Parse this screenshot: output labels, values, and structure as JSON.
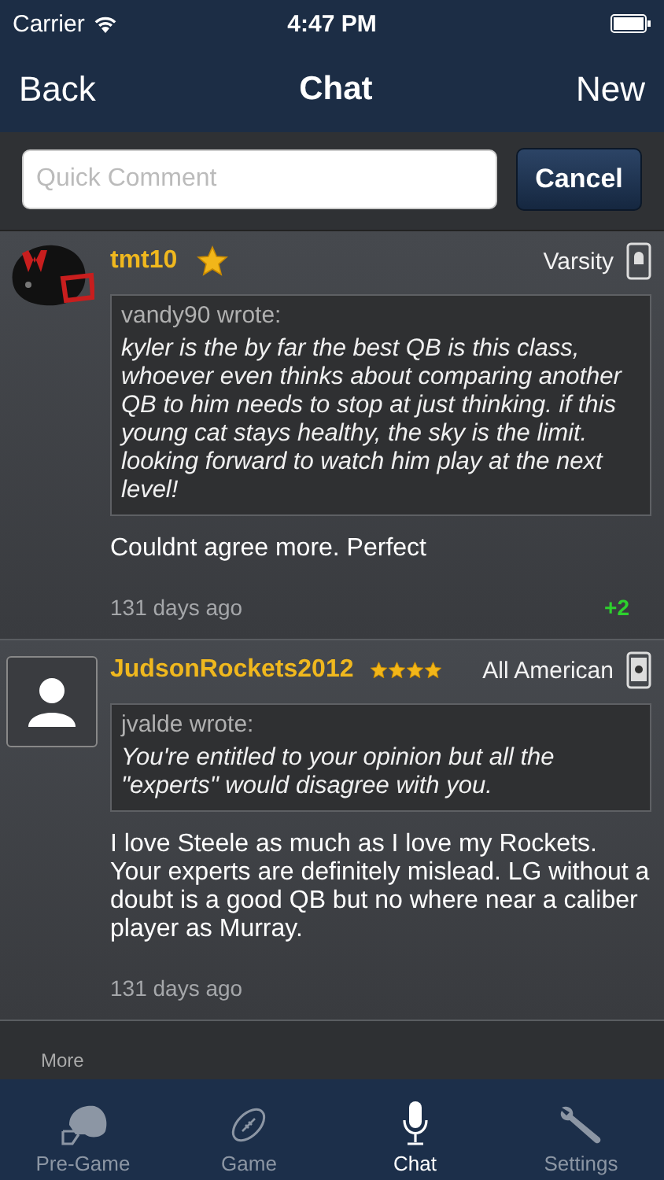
{
  "status_bar": {
    "carrier": "Carrier",
    "time": "4:47 PM"
  },
  "nav": {
    "back": "Back",
    "title": "Chat",
    "action": "New"
  },
  "comment": {
    "placeholder": "Quick Comment",
    "cancel": "Cancel"
  },
  "posts": [
    {
      "user": "tmt10",
      "rank": "Varsity",
      "quote_author": "vandy90 wrote:",
      "quote": "kyler is the by far the best QB is this class, whoever even thinks about comparing another QB to him needs to stop at just thinking. if this young cat stays healthy, the sky is the limit. looking forward to watch him play at the next level!",
      "body": "Couldnt agree more. Perfect",
      "time": "131 days ago",
      "votes": "+2"
    },
    {
      "user": "JudsonRockets2012",
      "rank": "All American",
      "quote_author": "jvalde wrote:",
      "quote": "You're entitled to your opinion but all the \"experts\" would disagree with you.",
      "body": "I love Steele as much as I love my Rockets. Your experts are definitely mislead. LG without a doubt is a good QB but no where near a caliber player as Murray.",
      "time": "131 days ago"
    }
  ],
  "more": "More",
  "tabs": [
    {
      "label": "Pre-Game",
      "selected": false
    },
    {
      "label": "Game",
      "selected": false
    },
    {
      "label": "Chat",
      "selected": true
    },
    {
      "label": "Settings",
      "selected": false
    }
  ]
}
